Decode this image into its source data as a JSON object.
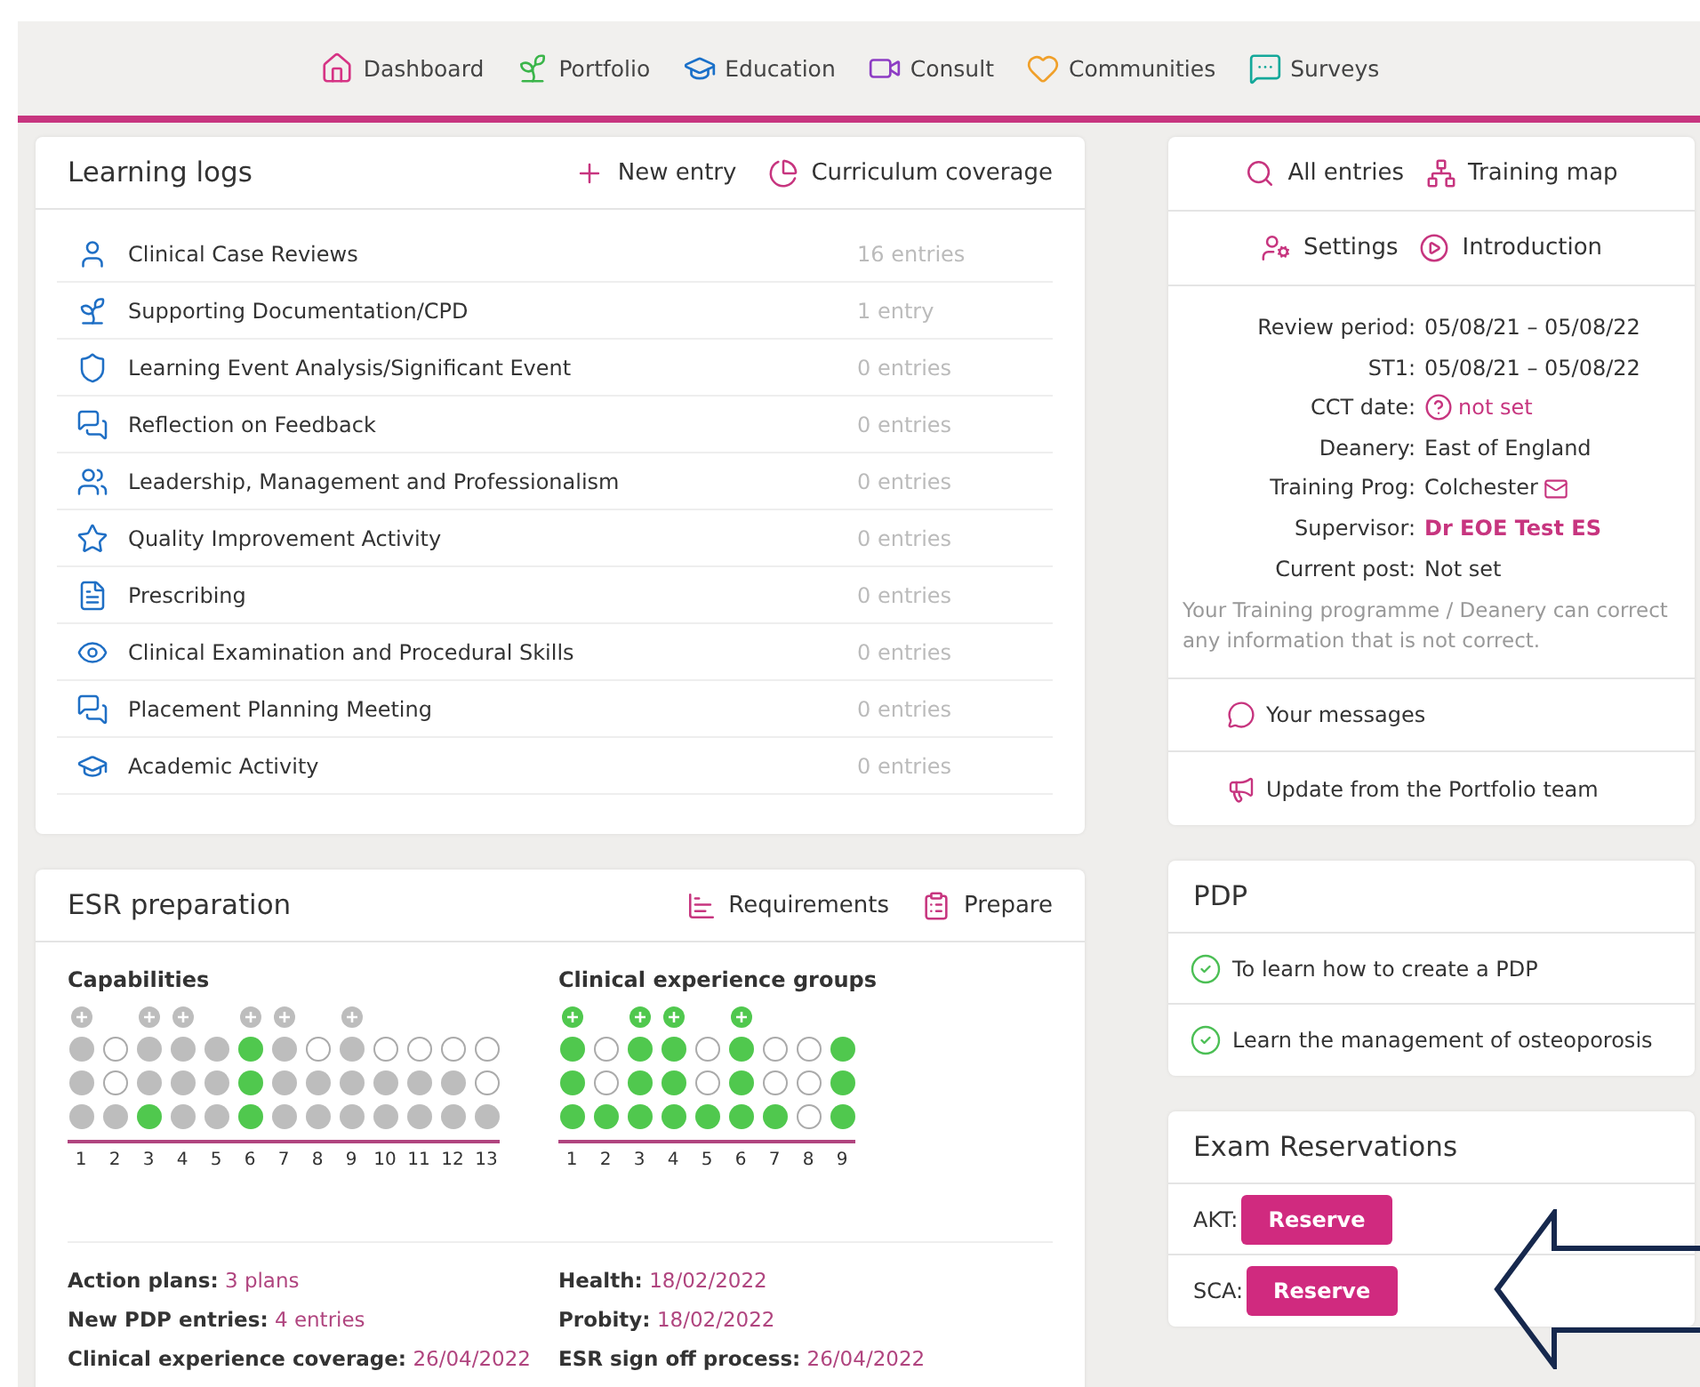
{
  "nav": [
    {
      "label": "Dashboard"
    },
    {
      "label": "Portfolio"
    },
    {
      "label": "Education"
    },
    {
      "label": "Consult"
    },
    {
      "label": "Communities"
    },
    {
      "label": "Surveys"
    }
  ],
  "learning_logs": {
    "title": "Learning logs",
    "actions": [
      {
        "label": "New entry"
      },
      {
        "label": "Curriculum coverage"
      }
    ],
    "rows": [
      {
        "name": "Clinical Case Reviews",
        "count": "16 entries"
      },
      {
        "name": "Supporting Documentation/CPD",
        "count": "1 entry"
      },
      {
        "name": "Learning Event Analysis/Significant Event",
        "count": "0 entries"
      },
      {
        "name": "Reflection on Feedback",
        "count": "0 entries"
      },
      {
        "name": "Leadership, Management and Professionalism",
        "count": "0 entries"
      },
      {
        "name": "Quality Improvement Activity",
        "count": "0 entries"
      },
      {
        "name": "Prescribing",
        "count": "0 entries"
      },
      {
        "name": "Clinical Examination and Procedural Skills",
        "count": "0 entries"
      },
      {
        "name": "Placement Planning Meeting",
        "count": "0 entries"
      },
      {
        "name": "Academic Activity",
        "count": "0 entries"
      }
    ]
  },
  "esr": {
    "title": "ESR preparation",
    "actions": [
      {
        "label": "Requirements"
      },
      {
        "label": "Prepare"
      }
    ],
    "grids": [
      {
        "title": "Capabilities",
        "plus_met": false,
        "columns": [
          {
            "label": "1",
            "plus": true,
            "dots": [
              {
                "filled": true,
                "met": false
              },
              {
                "filled": true,
                "met": false
              },
              {
                "filled": true,
                "met": false
              }
            ]
          },
          {
            "label": "2",
            "dots": [
              {
                "filled": false
              },
              {
                "filled": false
              },
              {
                "filled": true,
                "met": false
              }
            ]
          },
          {
            "label": "3",
            "plus": true,
            "dots": [
              {
                "filled": true,
                "met": false
              },
              {
                "filled": true,
                "met": false
              },
              {
                "filled": true,
                "met": true
              }
            ]
          },
          {
            "label": "4",
            "plus": true,
            "dots": [
              {
                "filled": true,
                "met": false
              },
              {
                "filled": true,
                "met": false
              },
              {
                "filled": true,
                "met": false
              }
            ]
          },
          {
            "label": "5",
            "dots": [
              {
                "filled": true,
                "met": false
              },
              {
                "filled": true,
                "met": false
              },
              {
                "filled": true,
                "met": false
              }
            ]
          },
          {
            "label": "6",
            "plus": true,
            "dots": [
              {
                "filled": true,
                "met": true
              },
              {
                "filled": true,
                "met": true
              },
              {
                "filled": true,
                "met": true
              }
            ]
          },
          {
            "label": "7",
            "plus": true,
            "dots": [
              {
                "filled": true,
                "met": false
              },
              {
                "filled": true,
                "met": false
              },
              {
                "filled": true,
                "met": false
              }
            ]
          },
          {
            "label": "8",
            "dots": [
              {
                "filled": false
              },
              {
                "filled": true,
                "met": false
              },
              {
                "filled": true,
                "met": false
              }
            ]
          },
          {
            "label": "9",
            "plus": true,
            "dots": [
              {
                "filled": true,
                "met": false
              },
              {
                "filled": true,
                "met": false
              },
              {
                "filled": true,
                "met": false
              }
            ]
          },
          {
            "label": "10",
            "dots": [
              {
                "filled": false
              },
              {
                "filled": true,
                "met": false
              },
              {
                "filled": true,
                "met": false
              }
            ]
          },
          {
            "label": "11",
            "dots": [
              {
                "filled": false
              },
              {
                "filled": true,
                "met": false
              },
              {
                "filled": true,
                "met": false
              }
            ]
          },
          {
            "label": "12",
            "dots": [
              {
                "filled": false
              },
              {
                "filled": true,
                "met": false
              },
              {
                "filled": true,
                "met": false
              }
            ]
          },
          {
            "label": "13",
            "dots": [
              {
                "filled": false
              },
              {
                "filled": false
              },
              {
                "filled": true,
                "met": false
              }
            ]
          }
        ]
      },
      {
        "title": "Clinical experience groups",
        "plus_met": true,
        "columns": [
          {
            "label": "1",
            "plus": true,
            "dots": [
              {
                "filled": true,
                "met": true
              },
              {
                "filled": true,
                "met": true
              },
              {
                "filled": true,
                "met": true
              }
            ]
          },
          {
            "label": "2",
            "dots": [
              {
                "filled": false
              },
              {
                "filled": false
              },
              {
                "filled": true,
                "met": true
              }
            ]
          },
          {
            "label": "3",
            "plus": true,
            "dots": [
              {
                "filled": true,
                "met": true
              },
              {
                "filled": true,
                "met": true
              },
              {
                "filled": true,
                "met": true
              }
            ]
          },
          {
            "label": "4",
            "plus": true,
            "dots": [
              {
                "filled": true,
                "met": true
              },
              {
                "filled": true,
                "met": true
              },
              {
                "filled": true,
                "met": true
              }
            ]
          },
          {
            "label": "5",
            "dots": [
              {
                "filled": false
              },
              {
                "filled": false
              },
              {
                "filled": true,
                "met": true
              }
            ]
          },
          {
            "label": "6",
            "plus": true,
            "dots": [
              {
                "filled": true,
                "met": true
              },
              {
                "filled": true,
                "met": true
              },
              {
                "filled": true,
                "met": true
              }
            ]
          },
          {
            "label": "7",
            "dots": [
              {
                "filled": false
              },
              {
                "filled": false
              },
              {
                "filled": true,
                "met": true
              }
            ]
          },
          {
            "label": "8",
            "dots": [
              {
                "filled": false
              },
              {
                "filled": false
              },
              {
                "filled": false
              }
            ]
          },
          {
            "label": "9",
            "dots": [
              {
                "filled": true,
                "met": true
              },
              {
                "filled": true,
                "met": true
              },
              {
                "filled": true,
                "met": true
              }
            ]
          }
        ]
      }
    ],
    "facts_left": [
      {
        "label": "Action plans:",
        "value": "3 plans"
      },
      {
        "label": "New PDP entries:",
        "value": "4 entries"
      },
      {
        "label": "Clinical experience coverage:",
        "value": "26/04/2022"
      }
    ],
    "facts_right": [
      {
        "label": "Health:",
        "value": "18/02/2022"
      },
      {
        "label": "Probity:",
        "value": "18/02/2022"
      },
      {
        "label": "ESR sign off process:",
        "value": "26/04/2022"
      }
    ]
  },
  "side": {
    "links_1": [
      {
        "label": "All entries"
      },
      {
        "label": "Training map"
      }
    ],
    "links_2": [
      {
        "label": "Settings"
      },
      {
        "label": "Introduction"
      }
    ],
    "info": [
      {
        "label": "Review period:",
        "value": "05/08/21 – 05/08/22",
        "kind": "plain"
      },
      {
        "label": "ST1:",
        "value": "05/08/21 – 05/08/22",
        "kind": "plain"
      },
      {
        "label": "CCT date:",
        "value": "not set",
        "kind": "unset"
      },
      {
        "label": "Deanery:",
        "value": "East of England",
        "kind": "plain"
      },
      {
        "label": "Training Prog:",
        "value": "Colchester",
        "kind": "email"
      },
      {
        "label": "Supervisor:",
        "value": "Dr EOE Test ES",
        "kind": "link"
      },
      {
        "label": "Current post:",
        "value": "Not set",
        "kind": "plain"
      }
    ],
    "note": "Your Training programme / Deanery can correct any information that is not correct.",
    "messages": "Your messages",
    "update": "Update from the Portfolio team"
  },
  "pdp": {
    "title": "PDP",
    "items": [
      {
        "text": "To learn how to create a PDP"
      },
      {
        "text": "Learn the management of osteoporosis"
      }
    ]
  },
  "exams": {
    "title": "Exam Reservations",
    "rows": [
      {
        "label": "AKT:",
        "button": "Reserve"
      },
      {
        "label": "SCA:",
        "button": "Reserve"
      }
    ]
  }
}
